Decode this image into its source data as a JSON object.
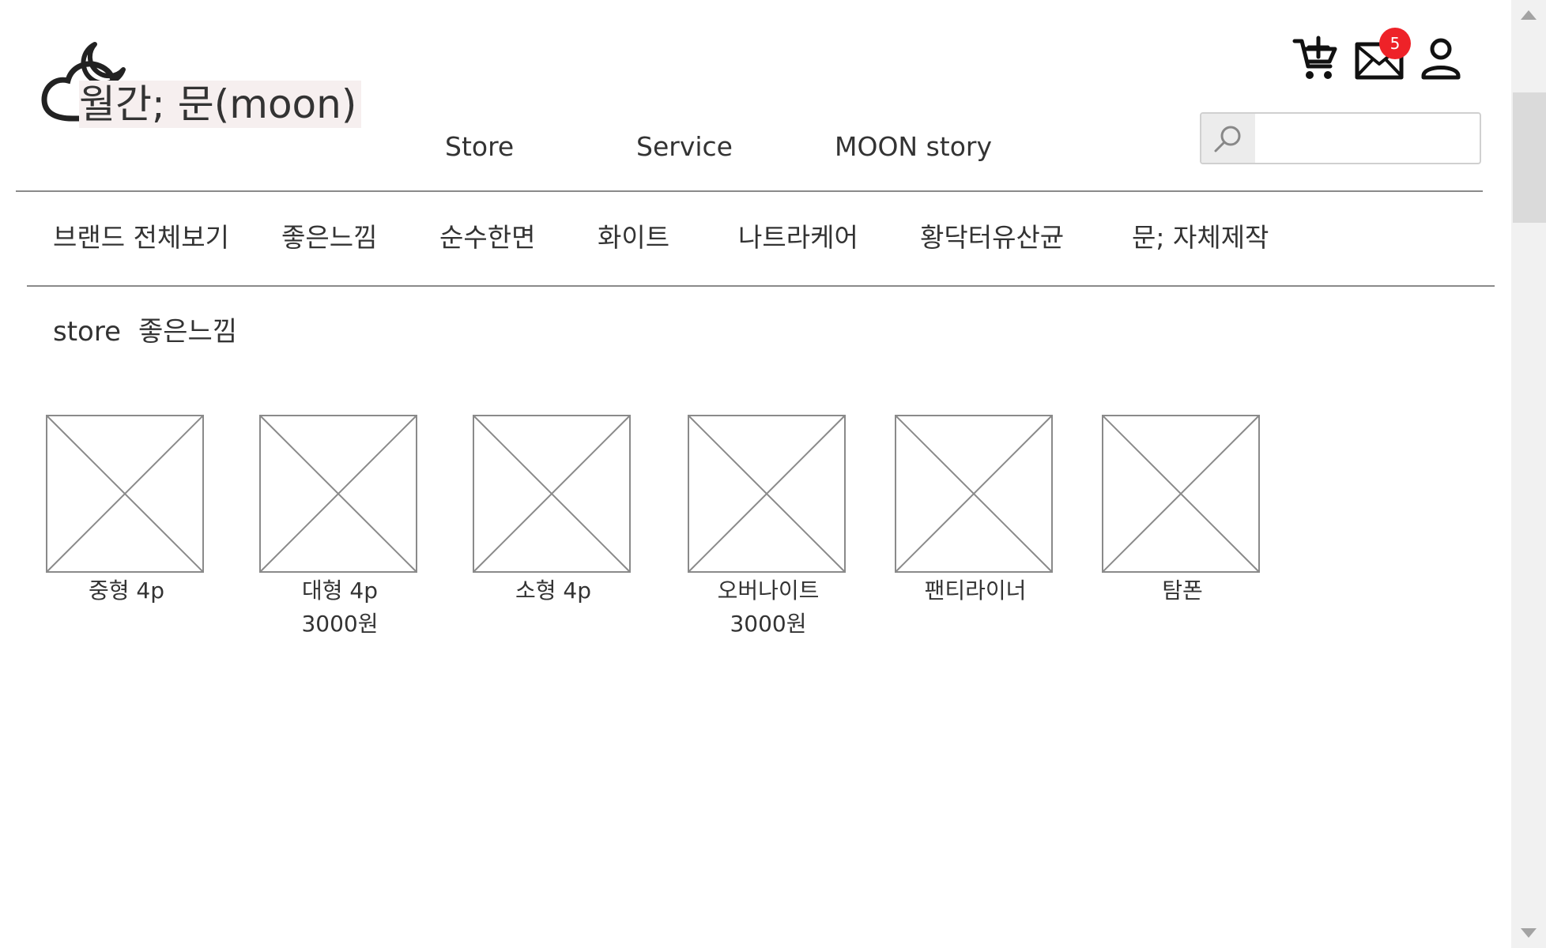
{
  "header": {
    "logo_text": "월간; 문(moon)",
    "nav": [
      "Store",
      "Service",
      "MOON story"
    ],
    "mail_badge_count": "5",
    "icons": [
      "cart-add-icon",
      "mail-icon",
      "user-icon",
      "search-icon"
    ]
  },
  "search": {
    "value": "",
    "placeholder": ""
  },
  "categories": [
    "브랜드 전체보기",
    "좋은느낌",
    "순수한면",
    "화이트",
    "나트라케어",
    "황닥터유산균",
    "문; 자체제작"
  ],
  "breadcrumb": {
    "section": "store",
    "current": "좋은느낌"
  },
  "products": [
    {
      "name": "중형 4p",
      "price": ""
    },
    {
      "name": "대형 4p",
      "price": "3000원"
    },
    {
      "name": "소형 4p",
      "price": ""
    },
    {
      "name": "오버나이트",
      "price": "3000원"
    },
    {
      "name": "팬티라이너",
      "price": ""
    },
    {
      "name": "탐폰",
      "price": ""
    }
  ],
  "colors": {
    "text": "#333333",
    "badge": "#ee2228",
    "divider": "#8a8a8a",
    "placeholder_stroke": "#8a8a8a"
  }
}
